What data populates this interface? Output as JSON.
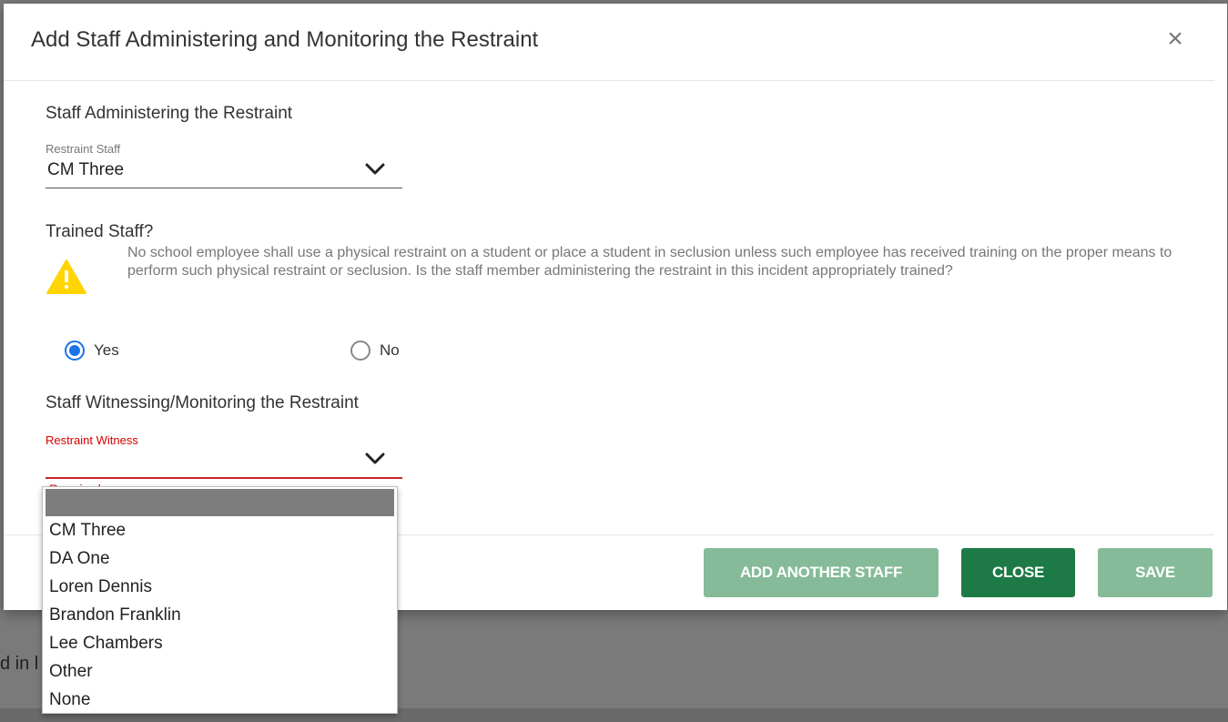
{
  "background": {
    "partial_text": "d in l"
  },
  "modal": {
    "title": "Add Staff Administering and Monitoring the Restraint",
    "close_glyph": "×",
    "sections": {
      "administering": {
        "heading": "Staff Administering the Restraint",
        "field_label": "Restraint Staff",
        "value": "CM Three"
      },
      "trained": {
        "heading": "Trained Staff?",
        "warning_text": "No school employee shall use a physical restraint on a student or place a student in seclusion unless such employee has received training on the proper means to perform such physical restraint or seclusion. Is the staff member administering the restraint in this incident appropriately trained?",
        "options": [
          {
            "label": "Yes",
            "checked": true
          },
          {
            "label": "No",
            "checked": false
          }
        ]
      },
      "witnessing": {
        "heading": "Staff Witnessing/Monitoring the Restraint",
        "field_label": "Restraint Witness",
        "value": "",
        "error_stub": "Required"
      }
    },
    "buttons": {
      "add_another": "ADD ANOTHER STAFF",
      "close": "CLOSE",
      "save": "SAVE"
    }
  },
  "dropdown": {
    "options": [
      "",
      "CM Three",
      "DA One",
      "Loren Dennis",
      "Brandon Franklin",
      "Lee Chambers",
      "Other",
      "None"
    ]
  },
  "colors": {
    "accent_blue": "#1a73e8",
    "error_red": "#d50000",
    "warning_yellow": "#ffd400",
    "button_primary": "#1d7a46",
    "button_disabled": "#85bb98"
  },
  "icons": {
    "close": "close-icon",
    "chevron": "chevron-down-icon",
    "warning": "warning-triangle-icon"
  }
}
